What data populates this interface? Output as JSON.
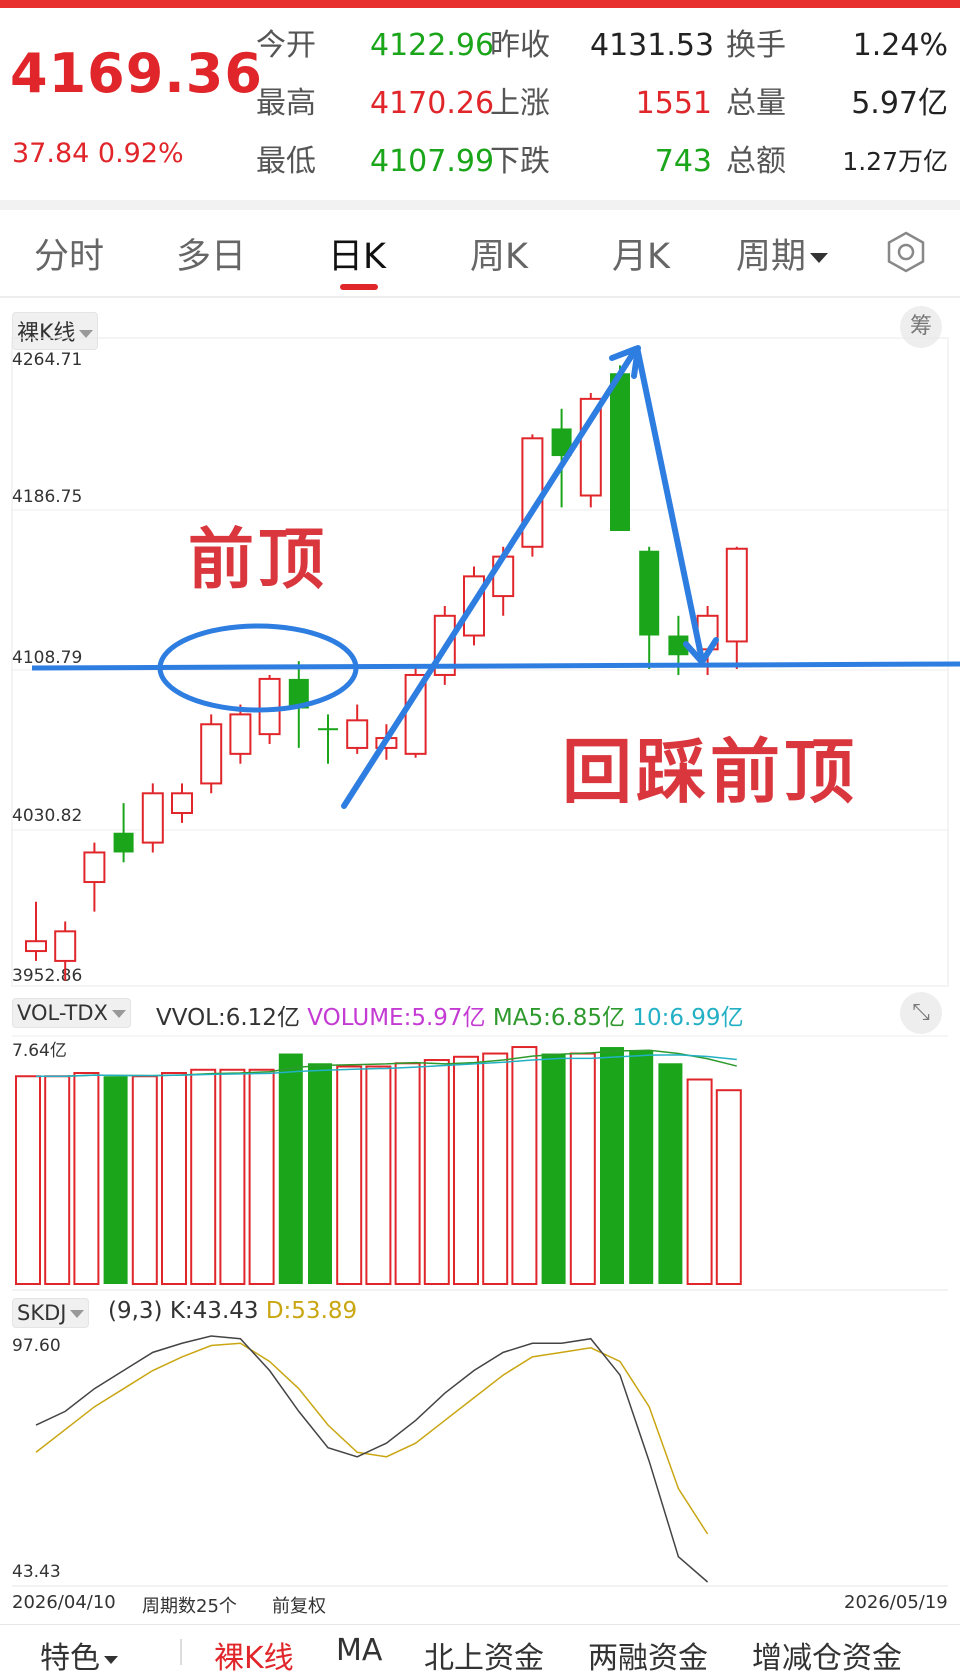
{
  "quote": {
    "price": "4169.36",
    "change": "37.84",
    "change_pct": "0.92%",
    "open_label": "今开",
    "open": "4122.96",
    "high_label": "最高",
    "high": "4170.26",
    "low_label": "最低",
    "low": "4107.99",
    "prev_close_label": "昨收",
    "prev_close": "4131.53",
    "up_label": "上涨",
    "up": "1551",
    "down_label": "下跌",
    "down": "743",
    "turnover_label": "换手",
    "turnover": "1.24%",
    "volume_label": "总量",
    "volume": "5.97亿",
    "amount_label": "总额",
    "amount": "1.27万亿"
  },
  "tabs": [
    "分时",
    "多日",
    "日K",
    "周K",
    "月K",
    "周期"
  ],
  "active_tab": "日K",
  "chart_header": {
    "mode_label": "裸K线",
    "chip_button": "筹"
  },
  "price_axis": [
    "4264.71",
    "4186.75",
    "4108.79",
    "4030.82",
    "3952.86"
  ],
  "annotations": {
    "prev_top": "前顶",
    "pullback": "回踩前顶"
  },
  "volume_panel": {
    "name": "VOL-TDX",
    "vvol": "VVOL:6.12亿",
    "volume": "VOLUME:5.97亿",
    "ma5": "MA5:6.85亿",
    "ma10": "10:6.99亿",
    "axis_max": "7.64亿"
  },
  "skdj_panel": {
    "name": "SKDJ",
    "params": "(9,3)",
    "k": "K:43.43",
    "d": "D:53.89",
    "axis_max": "97.60",
    "axis_min": "43.43"
  },
  "footer": {
    "start_date": "2026/04/10",
    "periods": "周期数25个",
    "adjust": "前复权",
    "end_date": "2026/05/19"
  },
  "bottom_tabs": [
    "特色",
    "裸K线",
    "MA",
    "北上资金",
    "两融资金",
    "增减仓资金"
  ],
  "colors": {
    "up": "#e0262a",
    "down": "#1aa51a",
    "annotation_blue": "#2e7de0",
    "annotation_red": "#e0262a"
  },
  "chart_data": {
    "type": "candlestick",
    "y_range": [
      3952.86,
      4264.71
    ],
    "candles": [
      {
        "o": 3965,
        "h": 3990,
        "l": 3960,
        "c": 3970
      },
      {
        "o": 3960,
        "h": 3980,
        "l": 3950,
        "c": 3975
      },
      {
        "o": 4000,
        "h": 4020,
        "l": 3985,
        "c": 4015
      },
      {
        "o": 4025,
        "h": 4040,
        "l": 4010,
        "c": 4015
      },
      {
        "o": 4020,
        "h": 4050,
        "l": 4015,
        "c": 4045
      },
      {
        "o": 4035,
        "h": 4050,
        "l": 4030,
        "c": 4045
      },
      {
        "o": 4050,
        "h": 4085,
        "l": 4045,
        "c": 4080
      },
      {
        "o": 4065,
        "h": 4090,
        "l": 4060,
        "c": 4085
      },
      {
        "o": 4075,
        "h": 4105,
        "l": 4070,
        "c": 4103
      },
      {
        "o": 4103,
        "h": 4112,
        "l": 4068,
        "c": 4088
      },
      {
        "o": 4078,
        "h": 4085,
        "l": 4060,
        "c": 4077
      },
      {
        "o": 4068,
        "h": 4090,
        "l": 4065,
        "c": 4082
      },
      {
        "o": 4068,
        "h": 4080,
        "l": 4062,
        "c": 4073
      },
      {
        "o": 4065,
        "h": 4110,
        "l": 4063,
        "c": 4105
      },
      {
        "o": 4105,
        "h": 4140,
        "l": 4100,
        "c": 4135
      },
      {
        "o": 4125,
        "h": 4160,
        "l": 4120,
        "c": 4155
      },
      {
        "o": 4145,
        "h": 4170,
        "l": 4135,
        "c": 4165
      },
      {
        "o": 4170,
        "h": 4227,
        "l": 4165,
        "c": 4225
      },
      {
        "o": 4230,
        "h": 4240,
        "l": 4190,
        "c": 4216
      },
      {
        "o": 4196,
        "h": 4248,
        "l": 4190,
        "c": 4245
      },
      {
        "o": 4258,
        "h": 4262,
        "l": 4178,
        "c": 4178
      },
      {
        "o": 4168,
        "h": 4170,
        "l": 4108,
        "c": 4125
      },
      {
        "o": 4125,
        "h": 4135,
        "l": 4105,
        "c": 4115
      },
      {
        "o": 4118,
        "h": 4140,
        "l": 4105,
        "c": 4135
      },
      {
        "o": 4122,
        "h": 4170,
        "l": 4108,
        "c": 4169
      }
    ],
    "volumes": [
      6.4,
      6.4,
      6.5,
      6.4,
      6.4,
      6.5,
      6.6,
      6.6,
      6.6,
      7.1,
      6.8,
      6.7,
      6.7,
      6.8,
      6.9,
      7.0,
      7.1,
      7.3,
      7.1,
      7.1,
      7.3,
      7.2,
      6.8,
      6.3,
      5.97
    ],
    "volume_max": 7.64,
    "skdj_range": [
      43.43,
      97.6
    ],
    "skdj_k": [
      78,
      81,
      86,
      90,
      94,
      96,
      97.6,
      97,
      90,
      81,
      73,
      71,
      74,
      79,
      85,
      90,
      94,
      96,
      96,
      97,
      89,
      70,
      49,
      43.43
    ],
    "skdj_d": [
      72,
      77,
      82,
      86,
      90,
      93,
      95.5,
      96,
      92,
      86,
      78,
      72,
      71,
      74,
      79,
      84,
      89,
      93,
      94,
      95,
      92,
      82,
      64,
      54
    ]
  }
}
